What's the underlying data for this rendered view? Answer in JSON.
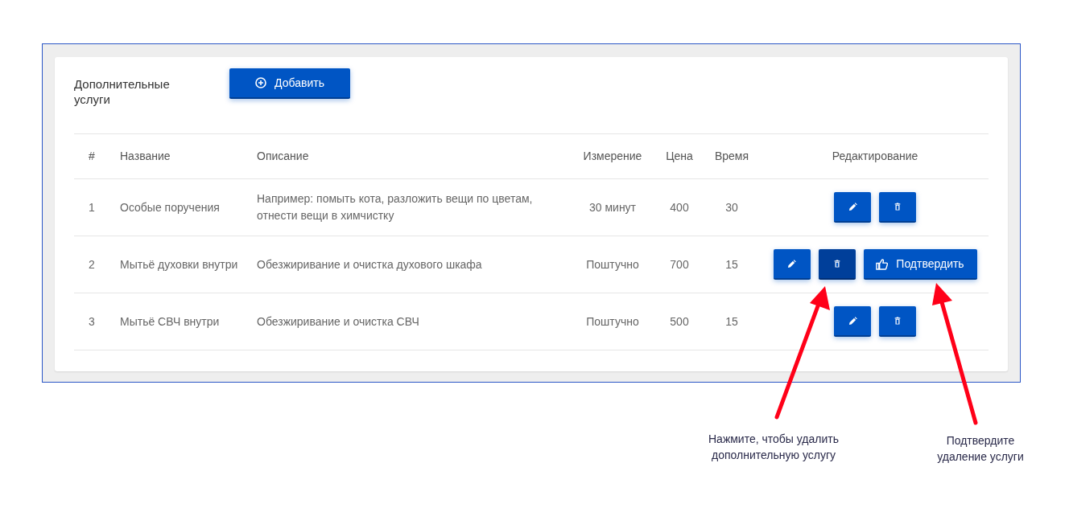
{
  "panel": {
    "title": "Дополнительные услуги",
    "add_button": {
      "label": "Добавить"
    }
  },
  "table": {
    "columns": [
      "#",
      "Название",
      "Описание",
      "Измерение",
      "Цена",
      "Время",
      "Редактирование"
    ],
    "rows": [
      {
        "cells": [
          "1",
          "Особые поручения",
          "Например: помыть кота, разложить вещи по цветам, отнести вещи в химчистку",
          "30 минут",
          "400",
          "30"
        ],
        "actions": [
          {
            "kind": "edit",
            "selected": false
          },
          {
            "kind": "delete",
            "selected": false
          }
        ]
      },
      {
        "cells": [
          "2",
          "Мытьё духовки внутри",
          "Обезжиривание и очистка духового шкафа",
          "Поштучно",
          "700",
          "15"
        ],
        "actions": [
          {
            "kind": "edit",
            "selected": false
          },
          {
            "kind": "delete",
            "selected": true
          },
          {
            "kind": "confirm",
            "label": "Подтвердить",
            "selected": false
          }
        ]
      },
      {
        "cells": [
          "3",
          "Мытьё СВЧ внутри",
          "Обезжиривание и очистка СВЧ",
          "Поштучно",
          "500",
          "15"
        ],
        "actions": [
          {
            "kind": "edit",
            "selected": false
          },
          {
            "kind": "delete",
            "selected": false
          }
        ]
      }
    ]
  },
  "annotations": [
    {
      "text": "Нажмите, чтобы удалить дополнительную услугу"
    },
    {
      "text": "Подтвердите удаление услуги"
    }
  ]
}
